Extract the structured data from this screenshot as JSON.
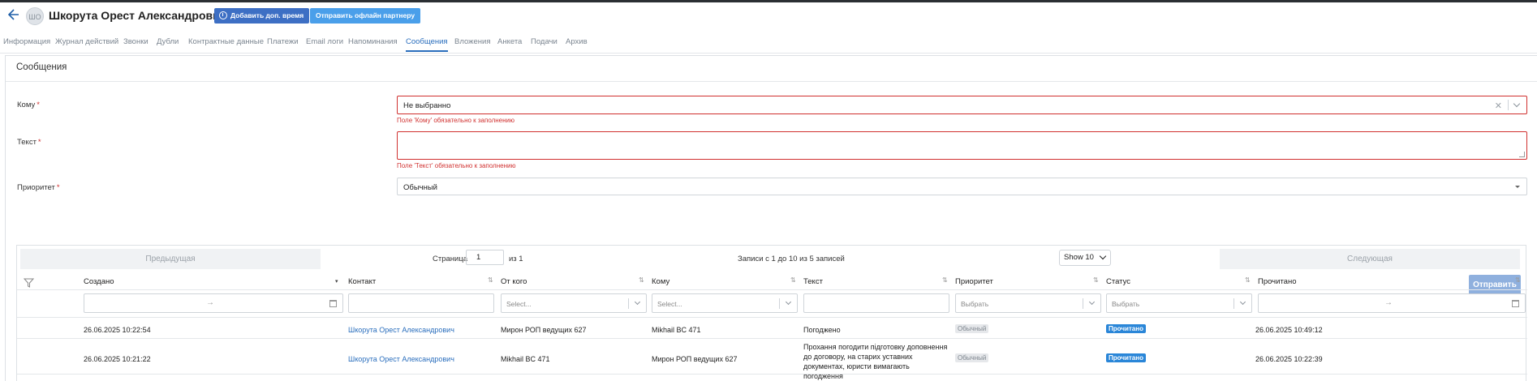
{
  "header": {
    "avatar_initials": "ШО",
    "title": "Шкорута Орест Александрович",
    "add_time_label": "Добавить доп. время",
    "send_offer_label": "Отправить офлайн партнеру"
  },
  "tabs": [
    {
      "label": "Информация"
    },
    {
      "label": "Журнал действий"
    },
    {
      "label": "Звонки"
    },
    {
      "label": "Дубли"
    },
    {
      "label": "Контрактные данные"
    },
    {
      "label": "Платежи"
    },
    {
      "label": "Email логи"
    },
    {
      "label": "Напоминания"
    },
    {
      "label": "Сообщения",
      "active": true
    },
    {
      "label": "Вложения"
    },
    {
      "label": "Анкета"
    },
    {
      "label": "Подачи"
    },
    {
      "label": "Архив"
    }
  ],
  "form": {
    "section_title": "Сообщения",
    "to_label": "Кому",
    "to_value": "Не выбранно",
    "to_error": "Поле 'Кому' обязательно к заполнению",
    "text_label": "Текст",
    "text_value": "",
    "text_error": "Поле 'Текст' обязательно к заполнению",
    "priority_label": "Приоритет",
    "priority_value": "Обычный",
    "required_mark": "*",
    "send_label": "Отправить"
  },
  "pager": {
    "prev_label": "Предыдущая",
    "page_label": "Страница",
    "page_value": "1",
    "of_label": "из 1",
    "records_text": "Записи с 1 до 10 из 5 записей",
    "show_label": "Show 10",
    "next_label": "Следующая"
  },
  "table": {
    "columns": [
      "Создано",
      "Контакт",
      "От кого",
      "Кому",
      "Текст",
      "Приоритет",
      "Статус",
      "Прочитано"
    ],
    "filters": {
      "from_placeholder": "Select...",
      "to_placeholder": "Select...",
      "priority_placeholder": "Выбрать",
      "status_placeholder": "Выбрать",
      "range_arrow": "→"
    },
    "rows": [
      {
        "created": "26.06.2025 10:22:54",
        "contact": "Шкорута Орест Александрович",
        "from": "Мирон РОП ведущих 627",
        "to": "Mikhail BC 471",
        "text": "Погоджено",
        "priority": "Обычный",
        "status": "Прочитано",
        "read_at": "26.06.2025 10:49:12"
      },
      {
        "created": "26.06.2025 10:21:22",
        "contact": "Шкорута Орест Александрович",
        "from": "Mikhail BC 471",
        "to": "Мирон РОП ведущих 627",
        "text": "Прохання погодити підготовку доповнення до договору, на старих уставних документах, юристи вимагають погодження",
        "priority": "Обычный",
        "status": "Прочитано",
        "read_at": "26.06.2025 10:22:39"
      }
    ]
  },
  "colors": {
    "accent": "#2a6ebd",
    "error": "#d0302f",
    "button_primary": "#3d6fc4",
    "button_secondary": "#4a9fea",
    "status_badge": "#2a86d8"
  }
}
